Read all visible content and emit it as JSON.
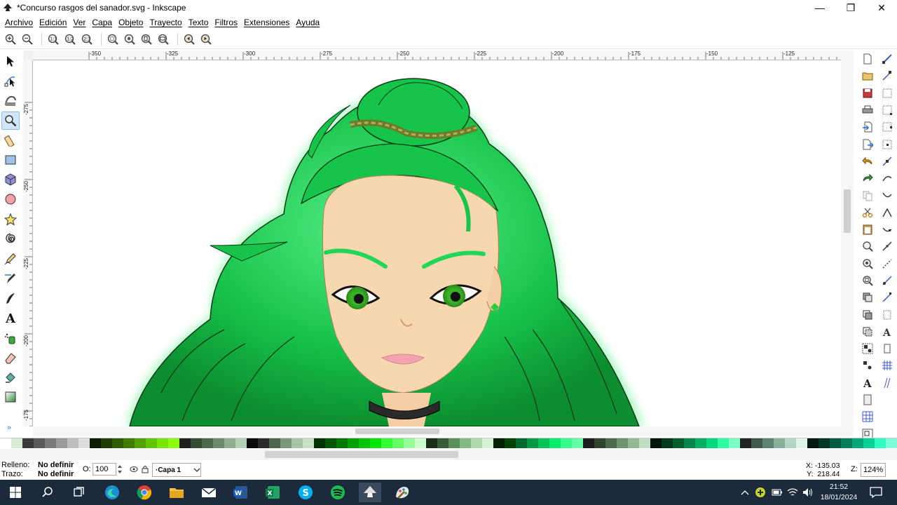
{
  "window": {
    "title": "*Concurso rasgos del sanador.svg - Inkscape",
    "minimize": "—",
    "restore": "❐",
    "close": "✕"
  },
  "menu": [
    "Archivo",
    "Edición",
    "Ver",
    "Capa",
    "Objeto",
    "Trayecto",
    "Texto",
    "Filtros",
    "Extensiones",
    "Ayuda"
  ],
  "commands": [
    "zoom-in-icon",
    "zoom-out-icon",
    "zoom-1-1-icon",
    "zoom-1-2-icon",
    "zoom-2-1-icon",
    "zoom-selection-icon",
    "zoom-drawing-icon",
    "zoom-page-icon",
    "zoom-page-width-icon",
    "zoom-previous-icon",
    "zoom-next-icon"
  ],
  "tools": [
    "selector-tool-icon",
    "node-tool-icon",
    "tweak-tool-icon",
    "zoom-tool-icon",
    "measure-tool-icon",
    "rectangle-tool-icon",
    "3d-box-tool-icon",
    "ellipse-tool-icon",
    "star-tool-icon",
    "spiral-tool-icon",
    "pencil-tool-icon",
    "pen-tool-icon",
    "calligraphy-tool-icon",
    "text-tool-icon",
    "spray-tool-icon",
    "eraser-tool-icon",
    "paint-bucket-tool-icon",
    "gradient-tool-icon"
  ],
  "tools_more": "»",
  "ruler": {
    "h_labels": [
      "-350",
      "-325",
      "-300",
      "-275",
      "-250",
      "-225",
      "-200",
      "-175",
      "-150",
      "-125"
    ],
    "v_labels": [
      "-275",
      "-250",
      "-225",
      "-200",
      "-175"
    ]
  },
  "rightbar1": [
    "new-document-icon",
    "open-icon",
    "save-icon",
    "print-icon",
    "import-icon",
    "export-icon",
    "undo-icon",
    "redo-icon",
    "copy-icon",
    "cut-icon",
    "paste-icon",
    "zoom-selection-icon",
    "zoom-drawing-icon",
    "zoom-page-icon",
    "duplicate-icon",
    "clone-icon",
    "unlink-clone-icon",
    "group-icon",
    "ungroup-icon",
    "text-font-icon",
    "fill-stroke-icon",
    "align-icon",
    "xml-editor-icon"
  ],
  "rightbar1_more": "»",
  "palette": [
    "#ffffff",
    "#d8ecd4",
    "#3a3a3a",
    "#5a5a5a",
    "#7a7a7a",
    "#9a9a9a",
    "#bdbdbd",
    "#dedede",
    "#0c1a00",
    "#1e3d00",
    "#2e5c00",
    "#3f7c00",
    "#52a100",
    "#65c400",
    "#7ae600",
    "#8dff0f",
    "#202020",
    "#334d33",
    "#4a6b4a",
    "#6b8c6b",
    "#8faf8f",
    "#b5d1b5",
    "#0a0a0a",
    "#2b2b2b",
    "#4e664e",
    "#79987a",
    "#a8c4a8",
    "#c7e2c7",
    "#003300",
    "#005500",
    "#007700",
    "#00a000",
    "#00c400",
    "#00e600",
    "#33ff33",
    "#66ff66",
    "#99ff99",
    "#ccffcc",
    "#1a2e1a",
    "#365c36",
    "#5b8f5b",
    "#84b884",
    "#addaad",
    "#d6f2d6",
    "#002200",
    "#004400",
    "#006a2e",
    "#009944",
    "#00c457",
    "#00ee6b",
    "#33ff8a",
    "#66ffa6",
    "#1d1d1d",
    "#2f452f",
    "#4b6b4b",
    "#6e916e",
    "#95b895",
    "#c1ddc1",
    "#00180c",
    "#003a1c",
    "#005e2d",
    "#00874a",
    "#00b062",
    "#00d97a",
    "#2bffa0",
    "#7affc4",
    "#232323",
    "#3d5a4a",
    "#5f8570",
    "#88b09a",
    "#b3d6c2",
    "#e0f5e8",
    "#001a12",
    "#003828",
    "#005a40",
    "#007d59",
    "#00a677",
    "#00d194",
    "#2cffc0",
    "#80ffdb"
  ],
  "status": {
    "fill_label": "Relleno:",
    "stroke_label": "Trazo:",
    "fill_value": "No definir",
    "stroke_value": "No definir",
    "opacity_label": "O:",
    "opacity_value": "100",
    "layer": "·Capa 1",
    "x": "X: -135.03",
    "y": "Y:  218.44",
    "zoom_label": "Z:",
    "zoom_value": "124%"
  },
  "taskbar": {
    "apps": [
      "windows-start-icon",
      "search-icon",
      "task-view-icon",
      "edge-icon",
      "chrome-icon",
      "file-explorer-icon",
      "mail-icon",
      "word-icon",
      "excel-icon",
      "skype-icon",
      "spotify-icon",
      "inkscape-icon",
      "paint-icon"
    ],
    "time": "21:52",
    "date": "18/01/2024"
  },
  "colors": {
    "hair": "#17c44a",
    "skin": "#f7d7b0",
    "accent": "#3a7dc9",
    "taskbar": "#1c2a3c"
  }
}
